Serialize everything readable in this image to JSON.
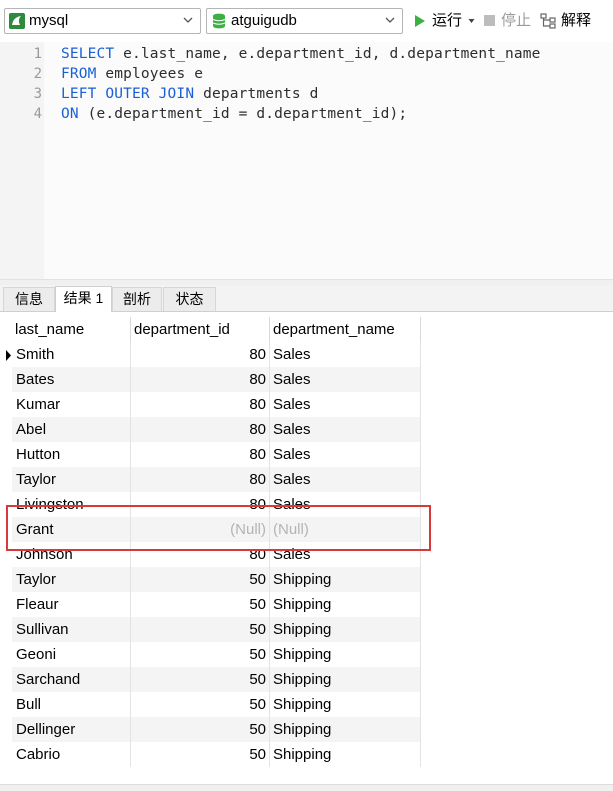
{
  "toolbar": {
    "connection": "mysql",
    "database": "atguigudb",
    "run_label": "运行",
    "stop_label": "停止",
    "explain_label": "解释"
  },
  "editor": {
    "line_numbers": [
      "1",
      "2",
      "3",
      "4"
    ],
    "lines": [
      {
        "kw": "SELECT",
        "rest": " e.last_name, e.department_id, d.department_name"
      },
      {
        "kw": "FROM",
        "rest": " employees e"
      },
      {
        "kw": "LEFT OUTER JOIN",
        "rest": " departments d"
      },
      {
        "kw": "ON",
        "rest": " (e.department_id = d.department_id);"
      }
    ]
  },
  "tabs": [
    {
      "label": "信息"
    },
    {
      "label": "结果 1"
    },
    {
      "label": "剖析"
    },
    {
      "label": "状态"
    }
  ],
  "grid": {
    "columns": [
      "last_name",
      "department_id",
      "department_name"
    ],
    "rows": [
      [
        "Smith",
        "80",
        "Sales"
      ],
      [
        "Bates",
        "80",
        "Sales"
      ],
      [
        "Kumar",
        "80",
        "Sales"
      ],
      [
        "Abel",
        "80",
        "Sales"
      ],
      [
        "Hutton",
        "80",
        "Sales"
      ],
      [
        "Taylor",
        "80",
        "Sales"
      ],
      [
        "Livingston",
        "80",
        "Sales"
      ],
      [
        "Grant",
        "(Null)",
        "(Null)"
      ],
      [
        "Johnson",
        "80",
        "Sales"
      ],
      [
        "Taylor",
        "50",
        "Shipping"
      ],
      [
        "Fleaur",
        "50",
        "Shipping"
      ],
      [
        "Sullivan",
        "50",
        "Shipping"
      ],
      [
        "Geoni",
        "50",
        "Shipping"
      ],
      [
        "Sarchand",
        "50",
        "Shipping"
      ],
      [
        "Bull",
        "50",
        "Shipping"
      ],
      [
        "Dellinger",
        "50",
        "Shipping"
      ],
      [
        "Cabrio",
        "50",
        "Shipping"
      ]
    ]
  },
  "colors": {
    "keyword": "#1a5fd6",
    "highlight_box": "#d9393a",
    "null_text": "#b4b4b4",
    "run_icon": "#3cb043",
    "db_icon": "#3cb043"
  }
}
